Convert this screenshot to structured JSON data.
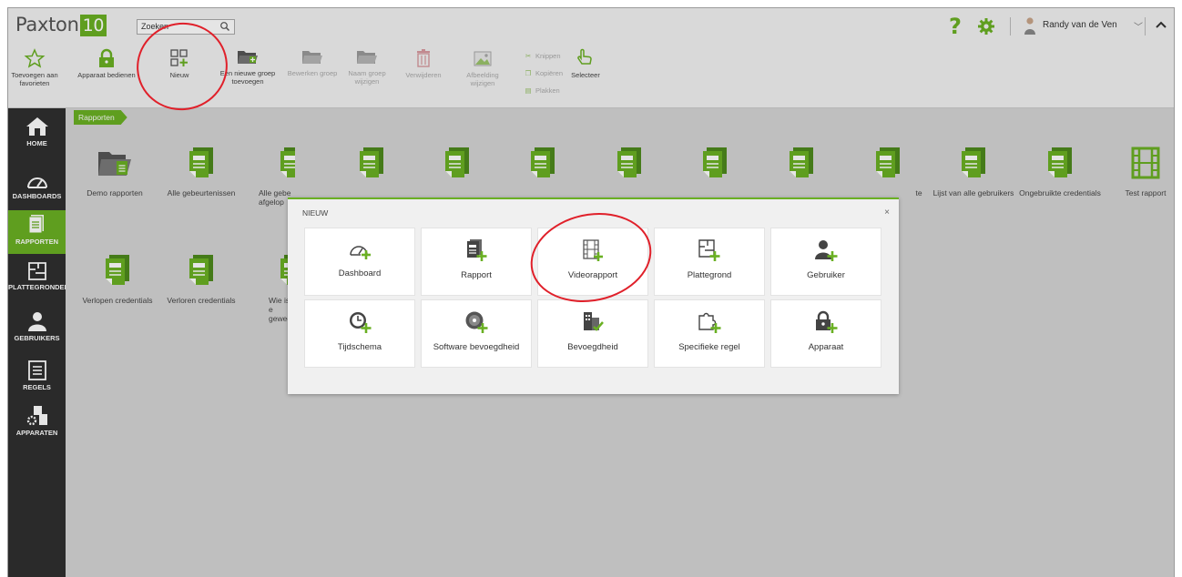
{
  "app": {
    "logo_text": "Paxton",
    "logo_version": "10"
  },
  "search": {
    "placeholder": "Zoeken"
  },
  "user": {
    "name": "Randy van de Ven"
  },
  "help_label": "?",
  "ribbon": {
    "add_favorite": "Toevoegen aan favorieten",
    "operate_device": "Apparaat bedienen",
    "new": "Nieuw",
    "new_group": "Een nieuwe groep toevoegen",
    "edit_group": "Bewerken groep",
    "rename_group": "Naam groep wijzigen",
    "delete": "Verwijderen",
    "change_image": "Afbeelding wijzigen",
    "cut": "Knippen",
    "copy": "Kopiëren",
    "paste": "Plakken",
    "select": "Selecteer"
  },
  "nav": {
    "home": "HOME",
    "dashboards": "DASHBOARDS",
    "reports": "RAPPORTEN",
    "floorplans": "PLATTEGRONDEN",
    "users": "GEBRUIKERS",
    "rules": "REGELS",
    "devices": "APPARATEN"
  },
  "breadcrumb": "Rapporten",
  "reports": {
    "demo": "Demo rapporten",
    "all_events": "Alle gebeurtenissen",
    "all_events_expired": "Alle gebe afgelop",
    "users_list": "Lijst van alle gebruikers",
    "unused_credentials": "Ongebruikte credentials",
    "test_report": "Test rapport",
    "expired_credentials": "Verlopen credentials",
    "lost_credentials": "Verloren credentials",
    "who_was": "Wie is e geweest",
    "partial_te": "te"
  },
  "modal": {
    "title": "NIEUW",
    "close": "×",
    "items": [
      "Dashboard",
      "Rapport",
      "Videorapport",
      "Plattegrond",
      "Gebruiker",
      "Tijdschema",
      "Software bevoegdheid",
      "Bevoegdheid",
      "Specifieke regel",
      "Apparaat"
    ]
  },
  "colors": {
    "brand_green": "#6ab023",
    "nav_dark": "#2f2f2f",
    "annotation_red": "#e0202a"
  }
}
